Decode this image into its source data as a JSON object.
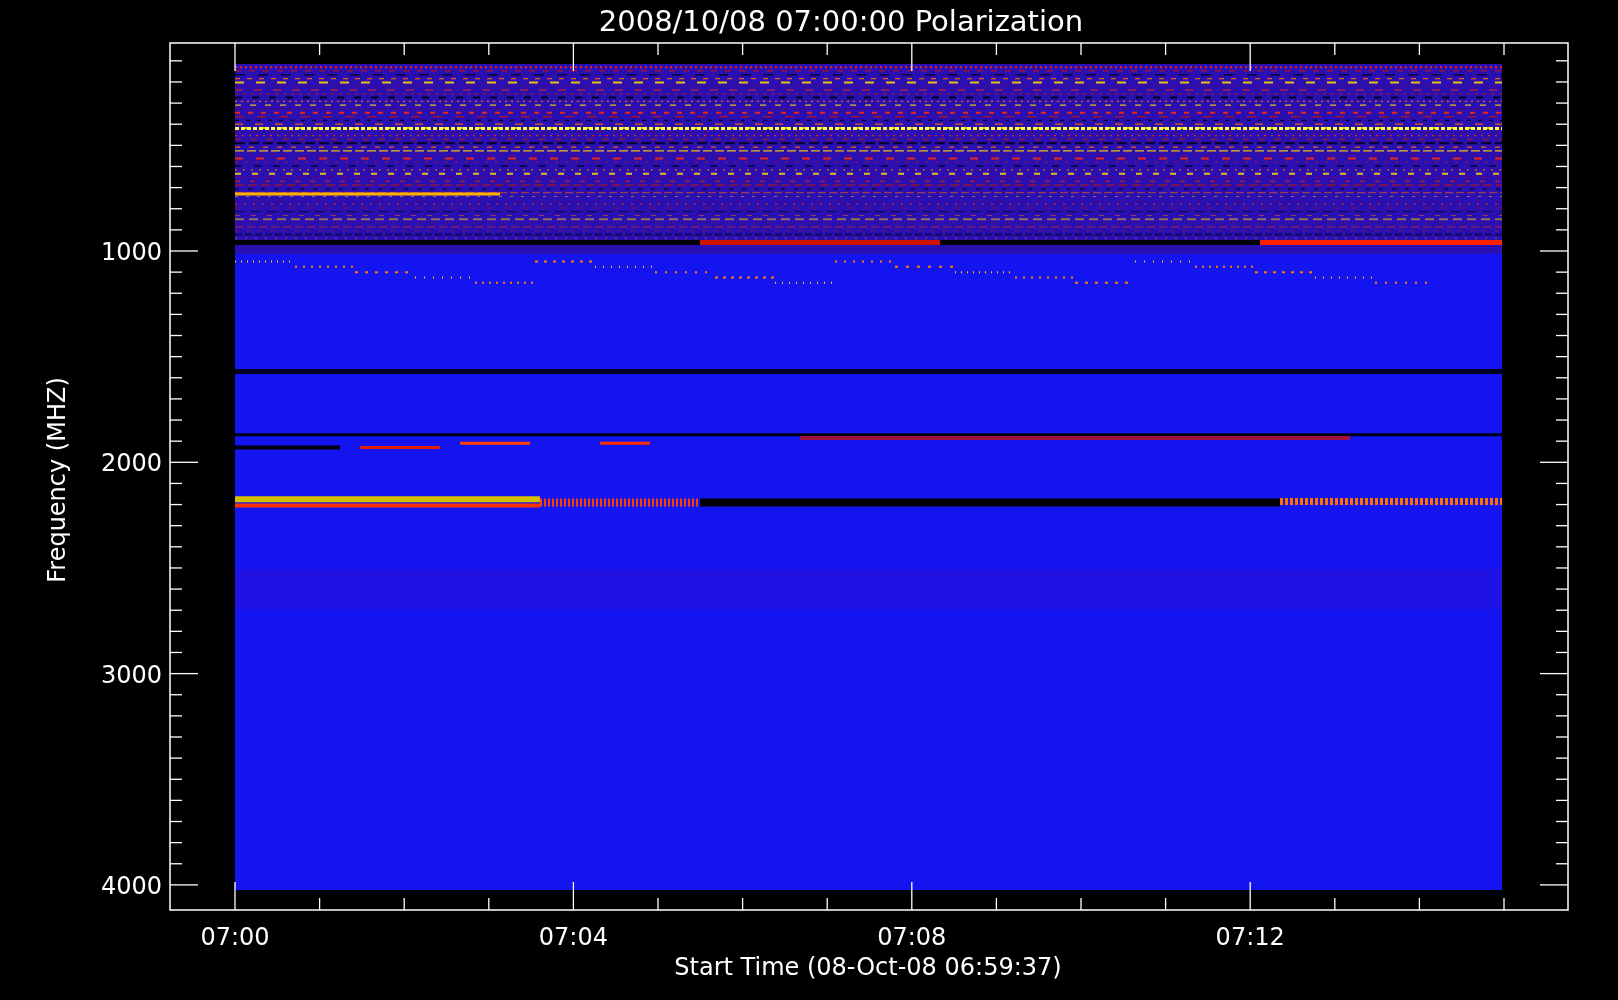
{
  "title": "2008/10/08 07:00:00 Polarization",
  "y_axis": {
    "label": "Frequency (MHZ)",
    "ticks": [
      "1000",
      "2000",
      "3000",
      "4000"
    ]
  },
  "x_axis": {
    "label": "Start Time (08-Oct-08 06:59:37)",
    "ticks": [
      "07:00",
      "07:04",
      "07:08",
      "07:12"
    ]
  }
}
